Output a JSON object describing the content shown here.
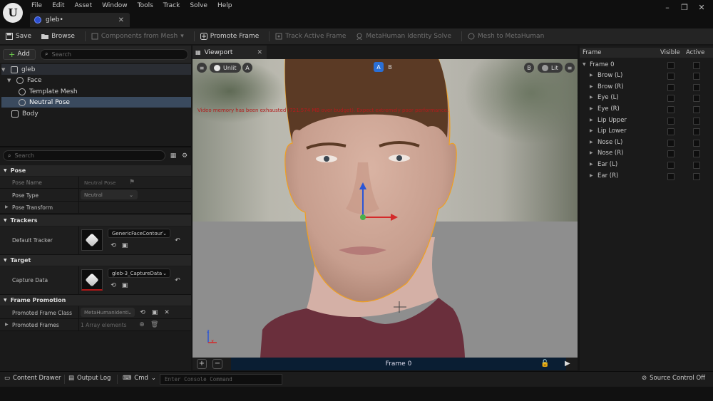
{
  "menu": [
    "File",
    "Edit",
    "Asset",
    "Window",
    "Tools",
    "Track",
    "Solve",
    "Help"
  ],
  "document_tab": {
    "title": "gleb•"
  },
  "toolbar": {
    "save": "Save",
    "browse": "Browse",
    "components_from_mesh": "Components from Mesh",
    "promote_frame": "Promote Frame",
    "track_active_frame": "Track Active Frame",
    "identity_solve": "MetaHuman Identity Solve",
    "mesh_to_metahuman": "Mesh to MetaHuman"
  },
  "outliner": {
    "add_label": "Add",
    "search_placeholder": "Search",
    "items": [
      {
        "label": "gleb",
        "icon": "identity-icon"
      },
      {
        "label": "Face",
        "icon": "face-icon"
      },
      {
        "label": "Template Mesh",
        "icon": "mesh-icon"
      },
      {
        "label": "Neutral Pose",
        "icon": "pose-icon"
      },
      {
        "label": "Body",
        "icon": "body-icon"
      }
    ]
  },
  "details": {
    "search_placeholder": "Search",
    "pose": {
      "category": "Pose",
      "pose_name_label": "Pose Name",
      "pose_name_value": "Neutral Pose",
      "pose_type_label": "Pose Type",
      "pose_type_value": "Neutral",
      "pose_transform_label": "Pose Transform"
    },
    "trackers": {
      "category": "Trackers",
      "default_tracker_label": "Default Tracker",
      "default_tracker_value": "GenericFaceContourTr"
    },
    "target": {
      "category": "Target",
      "capture_data_label": "Capture Data",
      "capture_data_value": "gleb-3_CaptureData"
    },
    "frame_promotion": {
      "category": "Frame Promotion",
      "promoted_frame_class_label": "Promoted Frame Class",
      "promoted_frame_class_value": "MetaHumanIdentit",
      "promoted_frames_label": "Promoted Frames",
      "promoted_frames_value": "1 Array elements"
    }
  },
  "viewport": {
    "tab_label": "Viewport",
    "unlit_label": "Unlit",
    "a_label": "A",
    "b_label": "B",
    "lit_label": "Lit",
    "warning": "Video memory has been exhausted (721.574 MB over budget). Expect extremely poor performance.",
    "frame_label": "Frame 0"
  },
  "frames_panel": {
    "col_frame": "Frame",
    "col_visible": "Visible",
    "col_active": "Active",
    "root": "Frame 0",
    "items": [
      "Brow (L)",
      "Brow (R)",
      "Eye (L)",
      "Eye (R)",
      "Lip Upper",
      "Lip Lower",
      "Nose (L)",
      "Nose (R)",
      "Ear (L)",
      "Ear (R)"
    ]
  },
  "statusbar": {
    "content_drawer": "Content Drawer",
    "output_log": "Output Log",
    "cmd": "Cmd",
    "console_placeholder": "Enter Console Command",
    "source_control": "Source Control Off"
  },
  "colors": {
    "accent_blue": "#2a6fd6",
    "selection": "#3a4a5e",
    "warning_red": "#b31b1b",
    "outline_orange": "#f0a020"
  }
}
